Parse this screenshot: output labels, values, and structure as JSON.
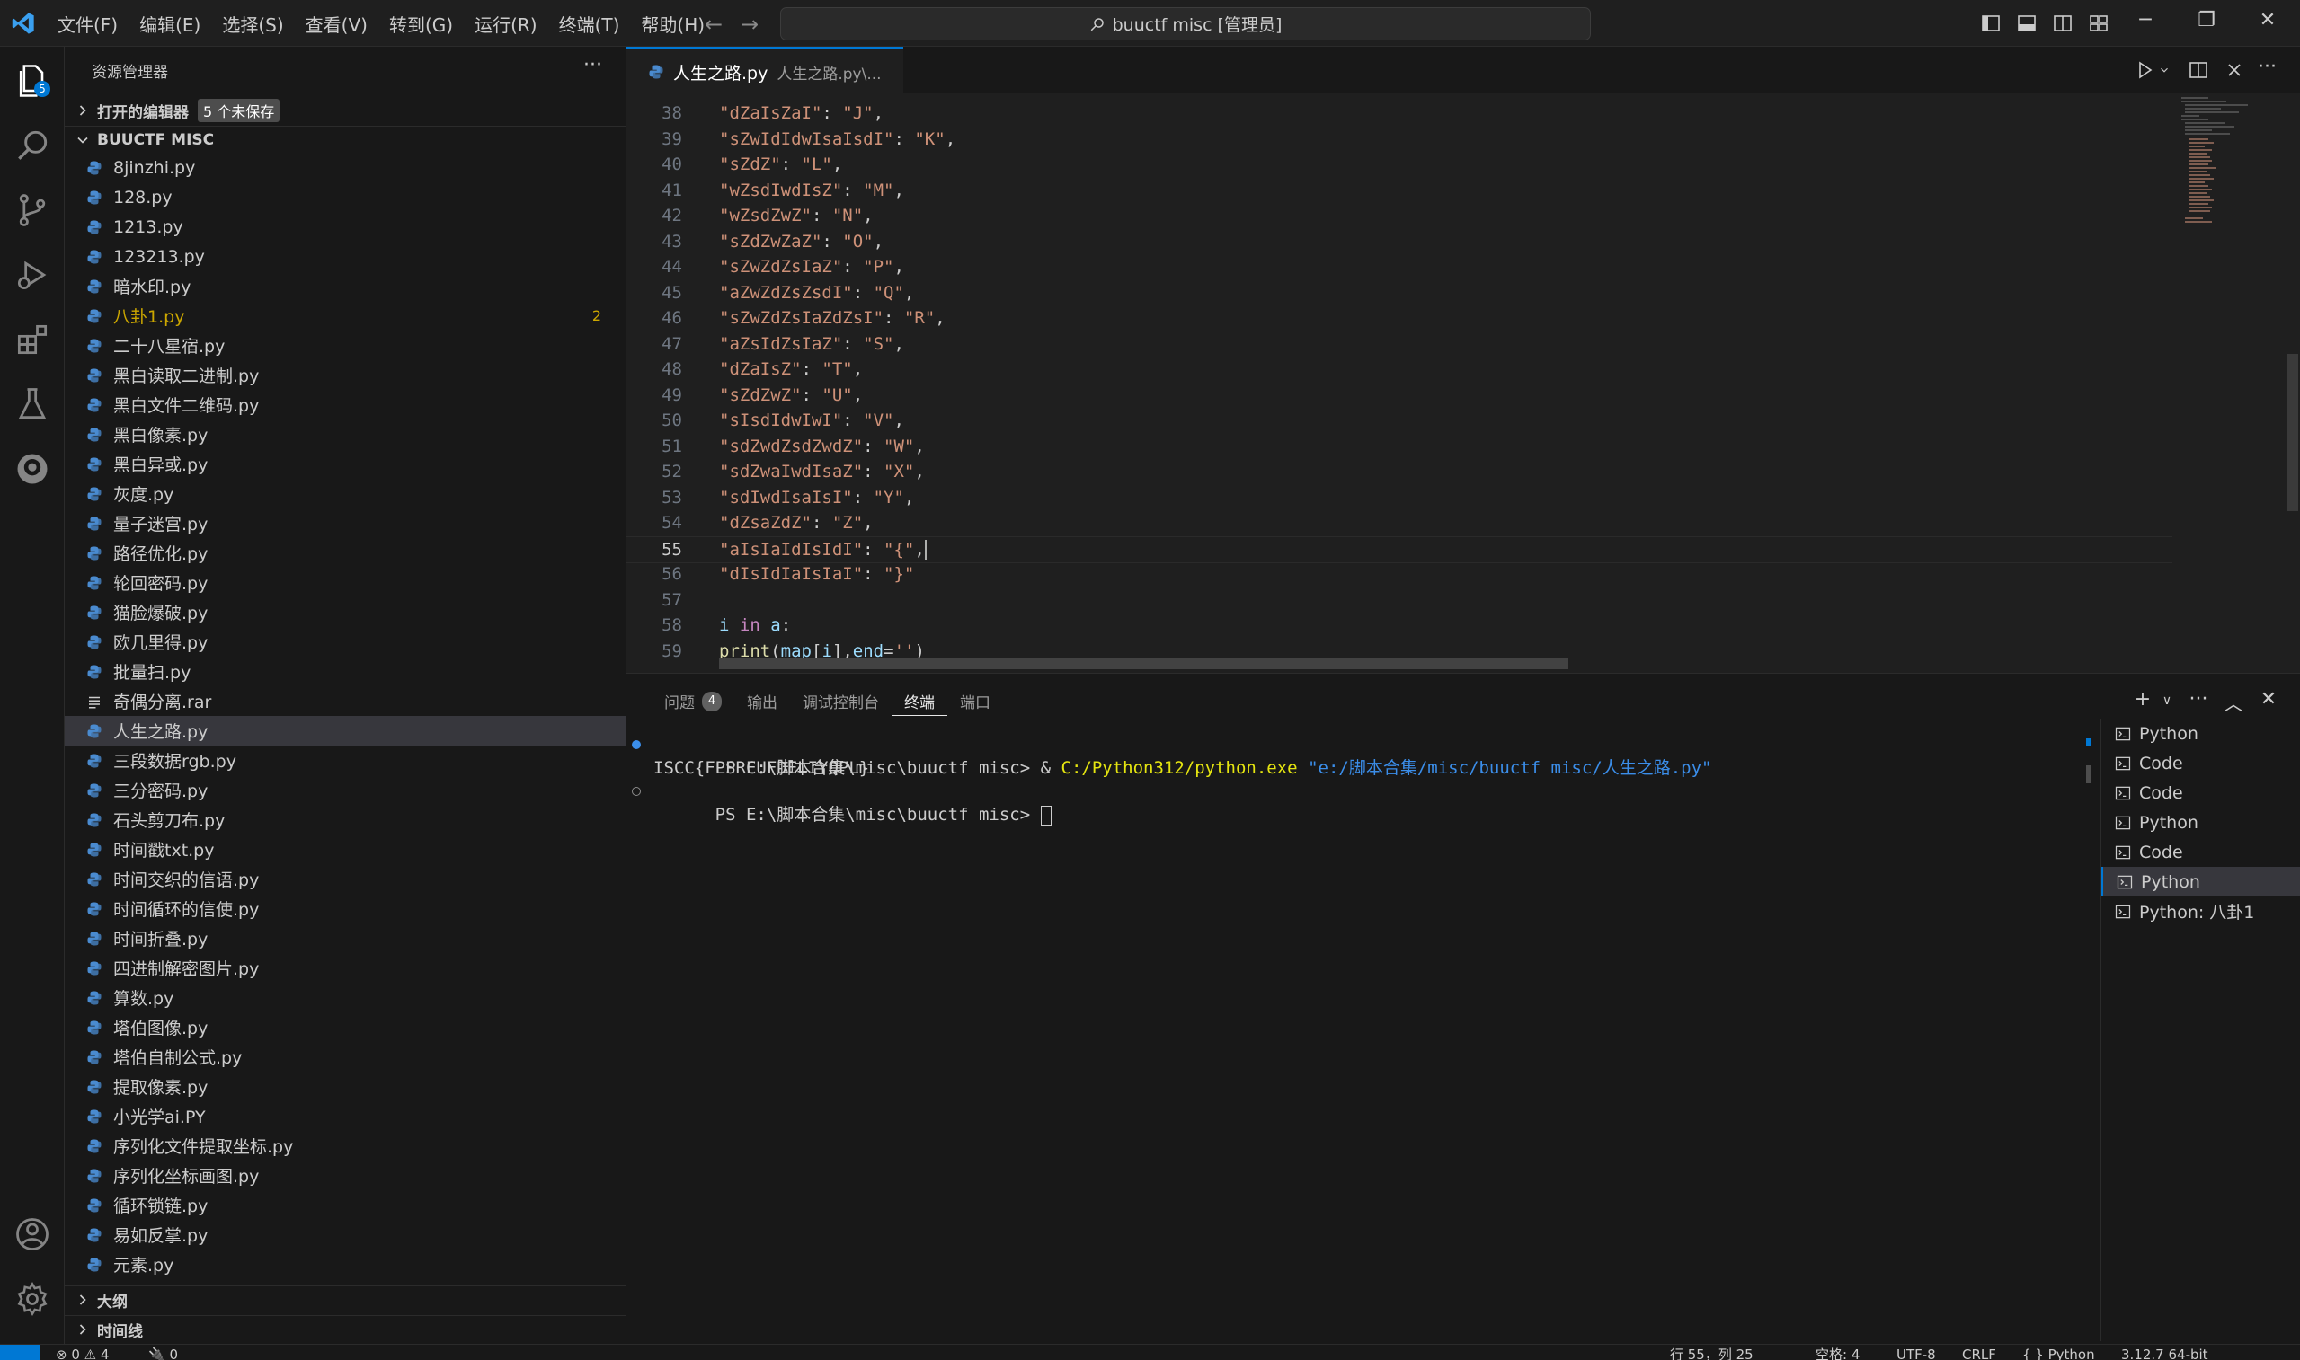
{
  "menu": [
    "文件(F)",
    "编辑(E)",
    "选择(S)",
    "查看(V)",
    "转到(G)",
    "运行(R)",
    "终端(T)",
    "帮助(H)"
  ],
  "command_center": "buuctf misc [管理员]",
  "activity": {
    "explorer_badge": "5"
  },
  "sidebar": {
    "title": "资源管理器",
    "open_editors": "打开的编辑器",
    "unsaved": "5 个未保存",
    "folder": "BUUCTF MISC",
    "files": [
      {
        "name": "8jinzhi.py"
      },
      {
        "name": "128.py"
      },
      {
        "name": "1213.py"
      },
      {
        "name": "123213.py"
      },
      {
        "name": "暗水印.py"
      },
      {
        "name": "八卦1.py",
        "count": "2",
        "warn": true
      },
      {
        "name": "二十八星宿.py"
      },
      {
        "name": "黑白读取二进制.py"
      },
      {
        "name": "黑白文件二维码.py"
      },
      {
        "name": "黑白像素.py"
      },
      {
        "name": "黑白异或.py"
      },
      {
        "name": "灰度.py"
      },
      {
        "name": "量子迷宫.py"
      },
      {
        "name": "路径优化.py"
      },
      {
        "name": "轮回密码.py"
      },
      {
        "name": "猫脸爆破.py"
      },
      {
        "name": "欧几里得.py"
      },
      {
        "name": "批量扫.py"
      },
      {
        "name": "奇偶分离.rar",
        "rar": true
      },
      {
        "name": "人生之路.py",
        "selected": true
      },
      {
        "name": "三段数据rgb.py"
      },
      {
        "name": "三分密码.py"
      },
      {
        "name": "石头剪刀布.py"
      },
      {
        "name": "时间戳txt.py"
      },
      {
        "name": "时间交织的信语.py"
      },
      {
        "name": "时间循环的信使.py"
      },
      {
        "name": "时间折叠.py"
      },
      {
        "name": "四进制解密图片.py"
      },
      {
        "name": "算数.py"
      },
      {
        "name": "塔伯图像.py"
      },
      {
        "name": "塔伯自制公式.py"
      },
      {
        "name": "提取像素.py"
      },
      {
        "name": "小光学ai.PY"
      },
      {
        "name": "序列化文件提取坐标.py"
      },
      {
        "name": "序列化坐标画图.py"
      },
      {
        "name": "循环锁链.py"
      },
      {
        "name": "易如反掌.py"
      },
      {
        "name": "元素.py"
      }
    ],
    "outline": "大纲",
    "timeline": "时间线"
  },
  "editor": {
    "tab_name": "人生之路.py",
    "tab_desc": "人生之路.py\\...",
    "current_line": 55,
    "lines": [
      {
        "n": "38",
        "key": "\"dZaIsZaI\"",
        "val": "\"J\""
      },
      {
        "n": "39",
        "key": "\"sZwIdIdwIsaIsdI\"",
        "val": "\"K\""
      },
      {
        "n": "40",
        "key": "\"sZdZ\"",
        "val": "\"L\""
      },
      {
        "n": "41",
        "key": "\"wZsdIwdIsZ\"",
        "val": "\"M\""
      },
      {
        "n": "42",
        "key": "\"wZsdZwZ\"",
        "val": "\"N\""
      },
      {
        "n": "43",
        "key": "\"sZdZwZaZ\"",
        "val": "\"O\""
      },
      {
        "n": "44",
        "key": "\"sZwZdZsIaZ\"",
        "val": "\"P\""
      },
      {
        "n": "45",
        "key": "\"aZwZdZsZsdI\"",
        "val": "\"Q\""
      },
      {
        "n": "46",
        "key": "\"sZwZdZsIaZdZsI\"",
        "val": "\"R\""
      },
      {
        "n": "47",
        "key": "\"aZsIdZsIaZ\"",
        "val": "\"S\""
      },
      {
        "n": "48",
        "key": "\"dZaIsZ\"",
        "val": "\"T\""
      },
      {
        "n": "49",
        "key": "\"sZdZwZ\"",
        "val": "\"U\""
      },
      {
        "n": "50",
        "key": "\"sIsdIdwIwI\"",
        "val": "\"V\""
      },
      {
        "n": "51",
        "key": "\"sdZwdZsdZwdZ\"",
        "val": "\"W\""
      },
      {
        "n": "52",
        "key": "\"sdZwaIwdIsaZ\"",
        "val": "\"X\""
      },
      {
        "n": "53",
        "key": "\"sdIwdIsaIsI\"",
        "val": "\"Y\""
      },
      {
        "n": "54",
        "key": "\"dZsaZdZ\"",
        "val": "\"Z\""
      },
      {
        "n": "55",
        "key": "\"aIsIaIdIsIdI\"",
        "val": "\"{\""
      },
      {
        "n": "56",
        "key": "\"dIsIdIaIsIaI\"",
        "val": "\"}\"",
        "last": true
      },
      {
        "n": "57"
      },
      {
        "n": "58",
        "code": "i in a:"
      },
      {
        "n": "59",
        "code": "print(map[i],end='')"
      }
    ]
  },
  "panel": {
    "tabs": [
      {
        "label": "问题",
        "badge": "4"
      },
      {
        "label": "输出"
      },
      {
        "label": "调试控制台"
      },
      {
        "label": "终端",
        "active": true
      },
      {
        "label": "端口"
      }
    ],
    "terminal": {
      "line1_prompt": "PS E:\\脚本合集\\misc\\buuctf misc> ",
      "line1_amp": "& ",
      "line1_exe": "C:/Python312/python.exe",
      "line1_arg": "\"e:/脚本合集/misc/buuctf misc/人生之路.py\"",
      "line2": "ISCC{FLPRCUFDELIYQPL}",
      "line3_prompt": "PS E:\\脚本合集\\misc\\buuctf misc> "
    },
    "terminals": [
      "Python",
      "Code",
      "Code",
      "Python",
      "Code",
      "Python",
      "Python: 八卦1"
    ],
    "active_terminal": 5
  },
  "statusbar": {
    "problems": "⊗ 0 ⚠ 4",
    "ports": "🔌 0",
    "position": "行 55，列 25",
    "spaces": "空格: 4",
    "encoding": "UTF-8",
    "eol": "CRLF",
    "language": "{ } Python",
    "interpreter": "3.12.7 64-bit"
  },
  "colors": {
    "accent": "#0078d4",
    "string": "#ce9178",
    "keyword": "#c586c0",
    "function": "#dcdcaa",
    "variable": "#9cdcfe",
    "warning": "#cca700"
  }
}
